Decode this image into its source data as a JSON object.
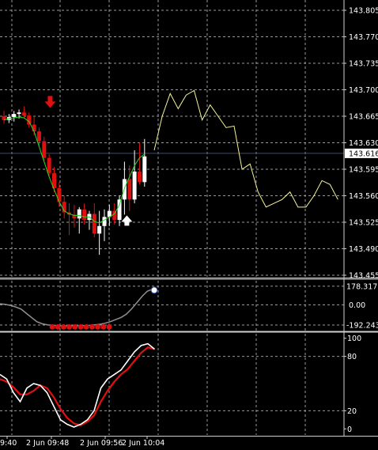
{
  "chart_data": {
    "type": "candlestick",
    "colors": {
      "background": "#000000",
      "grid": "#9a9a9a",
      "axis_text": "#ffffff",
      "bull_candle": "#ffffff",
      "bear_candle": "#e01010",
      "ma_line": "#22dd22",
      "forecast_line": "#f5f59a",
      "sell_arrow": "#e01010",
      "buy_arrow": "#ffffff",
      "cci_line": "#909090",
      "cci_dots": "#e01010",
      "stoch_main": "#ffffff",
      "stoch_signal": "#e01010",
      "current_price_line": "#3a4a7a",
      "price_tag_bg": "#ffffff"
    },
    "price_panel": {
      "y_ticks": [
        "143.805",
        "143.770",
        "143.735",
        "143.700",
        "143.665",
        "143.630",
        "143.595",
        "143.560",
        "143.525",
        "143.490",
        "143.455"
      ],
      "ylim": [
        143.455,
        143.805
      ],
      "current_price": 143.616,
      "current_price_label": "143.616",
      "grid": true,
      "candles": [
        [
          143.665,
          143.672,
          143.655,
          143.66
        ],
        [
          143.66,
          143.668,
          143.656,
          143.664
        ],
        [
          143.664,
          143.672,
          143.658,
          143.668
        ],
        [
          143.668,
          143.674,
          143.662,
          143.67
        ],
        [
          143.67,
          143.678,
          143.662,
          143.666
        ],
        [
          143.666,
          143.67,
          143.65,
          143.654
        ],
        [
          143.654,
          143.665,
          143.64,
          143.645
        ],
        [
          143.645,
          143.65,
          143.625,
          143.632
        ],
        [
          143.632,
          143.638,
          143.605,
          143.61
        ],
        [
          143.61,
          143.615,
          143.585,
          143.59
        ],
        [
          143.59,
          143.598,
          143.565,
          143.57
        ],
        [
          143.57,
          143.578,
          143.545,
          143.552
        ],
        [
          143.552,
          143.56,
          143.53,
          143.538
        ],
        [
          143.538,
          143.55,
          143.508,
          143.535
        ],
        [
          143.535,
          143.548,
          143.518,
          143.53
        ],
        [
          143.53,
          143.545,
          143.51,
          143.542
        ],
        [
          143.542,
          143.55,
          143.522,
          143.528
        ],
        [
          143.528,
          143.54,
          143.515,
          143.536
        ],
        [
          143.536,
          143.55,
          143.505,
          143.51
        ],
        [
          143.51,
          143.54,
          143.482,
          143.52
        ],
        [
          143.52,
          143.542,
          143.5,
          143.532
        ],
        [
          143.532,
          143.548,
          143.52,
          143.54
        ],
        [
          143.54,
          143.55,
          143.522,
          143.528
        ],
        [
          143.528,
          143.56,
          143.52,
          143.555
        ],
        [
          143.555,
          143.605,
          143.535,
          143.582
        ],
        [
          143.582,
          143.6,
          143.54,
          143.555
        ],
        [
          143.555,
          143.62,
          143.55,
          143.592
        ],
        [
          143.592,
          143.63,
          143.575,
          143.578
        ],
        [
          143.578,
          143.635,
          143.572,
          143.612
        ]
      ],
      "ma_line": [
        143.66,
        143.662,
        143.663,
        143.664,
        143.663,
        143.658,
        143.645,
        143.625,
        143.605,
        143.585,
        143.568,
        143.552,
        143.54,
        143.536,
        143.534,
        143.534,
        143.532,
        143.532,
        143.526,
        143.524,
        143.528,
        143.532,
        143.536,
        143.548,
        143.57,
        143.585,
        143.6,
        143.61,
        143.615
      ],
      "forecast_line": [
        143.62,
        143.665,
        143.695,
        143.675,
        143.693,
        143.699,
        143.66,
        143.68,
        143.665,
        143.65,
        143.652,
        143.595,
        143.602,
        143.565,
        143.545,
        143.55,
        143.555,
        143.565,
        143.545,
        143.545,
        143.56,
        143.58,
        143.575,
        143.555
      ],
      "sell_arrow_candle": 7,
      "buy_arrow_candle": 24
    },
    "cci_panel": {
      "labels": [
        "178.3173",
        "0.00",
        "-192.2431"
      ],
      "ylim": [
        -230,
        230
      ],
      "levels": [
        178.3173,
        0,
        -192.2431
      ],
      "line": [
        10,
        5,
        -5,
        -20,
        -40,
        -80,
        -120,
        -160,
        -180,
        -190,
        -195,
        -198,
        -200,
        -200,
        -200,
        -199,
        -197,
        -195,
        -190,
        -185,
        -175,
        -160,
        -140,
        -120,
        -90,
        -40,
        20,
        80,
        130,
        150
      ],
      "dots": [
        -195,
        -195,
        -195,
        -195,
        -195,
        -195,
        -195,
        -195,
        -195,
        -195,
        -195
      ],
      "dots_start": 8,
      "last_dot": 140
    },
    "stoch_panel": {
      "y_ticks": [
        100,
        80,
        20,
        0
      ],
      "ylim": [
        -5,
        105
      ],
      "main": [
        60,
        55,
        40,
        30,
        45,
        50,
        48,
        40,
        25,
        10,
        5,
        2,
        5,
        10,
        20,
        45,
        55,
        60,
        65,
        75,
        85,
        92,
        94,
        88
      ],
      "signal": [
        55,
        52,
        46,
        38,
        38,
        42,
        48,
        45,
        35,
        22,
        12,
        6,
        4,
        8,
        15,
        30,
        42,
        52,
        60,
        66,
        75,
        84,
        90,
        88
      ]
    },
    "x_tick_labels": [
      "9:40",
      "2 Jun 09:48",
      "2 Jun 09:56",
      "2 Jun 10:04"
    ]
  }
}
